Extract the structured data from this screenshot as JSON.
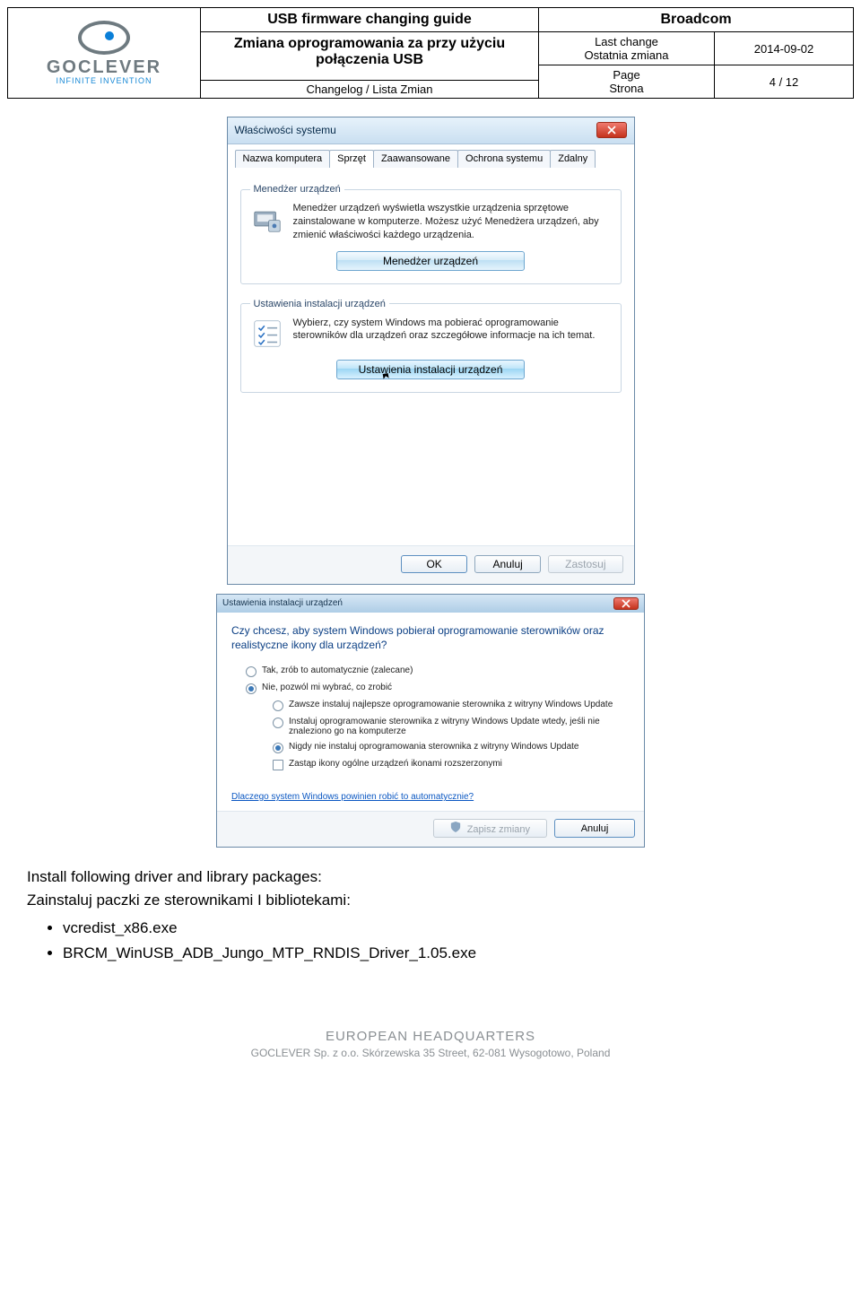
{
  "header": {
    "logo_text": "GOCLEVER",
    "logo_sub": "INFINITE INVENTION",
    "title_en": "USB firmware changing guide",
    "title_pl": "Zmiana oprogramowania za przy użyciu połączenia USB",
    "changelog": "Changelog / Lista Zmian",
    "brand": "Broadcom",
    "last_change_label_en": "Last change",
    "last_change_label_pl": "Ostatnia zmiana",
    "last_change_value": "2014-09-02",
    "page_label_en": "Page",
    "page_label_pl": "Strona",
    "page_value": "4 / 12"
  },
  "dlg1": {
    "title": "Właściwości systemu",
    "tabs": [
      "Nazwa komputera",
      "Sprzęt",
      "Zaawansowane",
      "Ochrona systemu",
      "Zdalny"
    ],
    "active_tab_idx": 1,
    "group_devmgr": {
      "legend": "Menedżer urządzeń",
      "desc": "Menedżer urządzeń wyświetla wszystkie urządzenia sprzętowe zainstalowane w komputerze. Możesz użyć Menedżera urządzeń, aby zmienić właściwości każdego urządzenia.",
      "button": "Menedżer urządzeń"
    },
    "group_inst": {
      "legend": "Ustawienia instalacji urządzeń",
      "desc": "Wybierz, czy system Windows ma pobierać oprogramowanie sterowników dla urządzeń oraz szczegółowe informacje na ich temat.",
      "button": "Ustawienia instalacji urządzeń"
    },
    "footer": {
      "ok": "OK",
      "cancel": "Anuluj",
      "apply": "Zastosuj"
    }
  },
  "dlg2": {
    "title": "Ustawienia instalacji urządzeń",
    "question": "Czy chcesz, aby system Windows pobierał oprogramowanie sterowników oraz realistyczne ikony dla urządzeń?",
    "opt_auto": "Tak, zrób to automatycznie (zalecane)",
    "opt_choose": "Nie, pozwól mi wybrać, co zrobić",
    "sub_always": "Zawsze instaluj najlepsze oprogramowanie sterownika z witryny Windows Update",
    "sub_ifnotfound": "Instaluj oprogramowanie sterownika z witryny Windows Update wtedy, jeśli nie znaleziono go na komputerze",
    "sub_never": "Nigdy nie instaluj oprogramowania sterownika z witryny Windows Update",
    "chk_icons": "Zastąp ikony ogólne urządzeń ikonami rozszerzonymi",
    "why_link": "Dlaczego system Windows powinien robić to automatycznie?",
    "save": "Zapisz zmiany",
    "cancel": "Anuluj"
  },
  "body": {
    "line_en": "Install following driver and library packages:",
    "line_pl": "Zainstaluj paczki ze sterownikami I bibliotekami:",
    "bullets": [
      "vcredist_x86.exe",
      "BRCM_WinUSB_ADB_Jungo_MTP_RNDIS_Driver_1.05.exe"
    ]
  },
  "footer_doc": {
    "eh": "EUROPEAN HEADQUARTERS",
    "addr": "GOCLEVER Sp. z o.o. Skórzewska 35 Street, 62-081 Wysogotowo, Poland"
  }
}
